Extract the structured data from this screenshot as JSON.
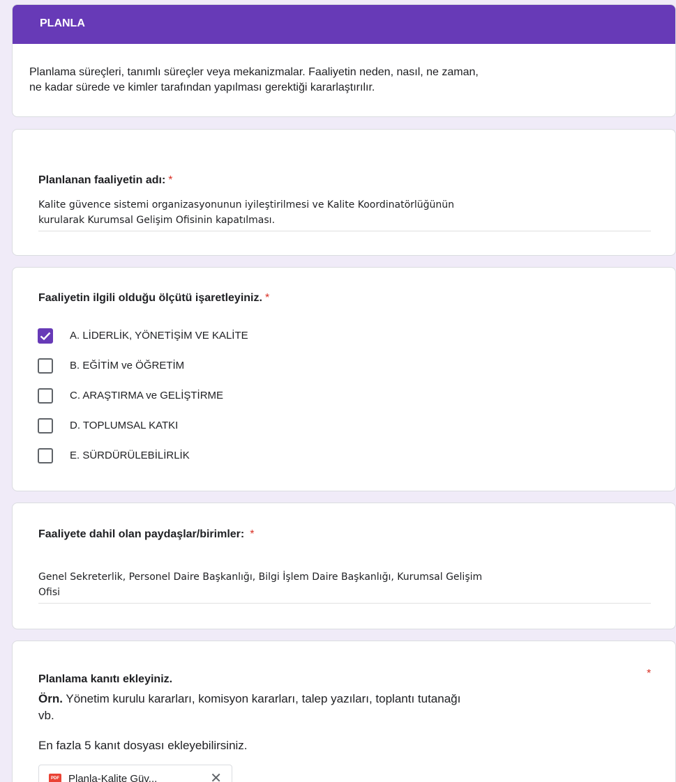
{
  "section": {
    "title": "PLANLA",
    "description_line1": "Planlama süreçleri, tanımlı süreçler veya mekanizmalar. Faaliyetin neden, nasıl, ne zaman,",
    "description_line2": "ne kadar sürede ve kimler tarafından yapılması gerektiği kararlaştırılır."
  },
  "q1": {
    "title": "Planlanan faaliyetin adı:",
    "required_mark": "*",
    "answer_line1": "Kalite güvence sistemi organizasyonunun iyileştirilmesi ve Kalite Koordinatörlüğünün",
    "answer_line2": "kurularak Kurumsal Gelişim Ofisinin kapatılması."
  },
  "q2": {
    "title": "Faaliyetin ilgili olduğu ölçütü işaretleyiniz.",
    "required_mark": "*",
    "options": [
      {
        "label": "A. LİDERLİK, YÖNETİŞİM VE KALİTE",
        "checked": true
      },
      {
        "label": "B. EĞİTİM ve ÖĞRETİM",
        "checked": false
      },
      {
        "label": "C. ARAŞTIRMA ve GELİŞTİRME",
        "checked": false
      },
      {
        "label": "D. TOPLUMSAL KATKI",
        "checked": false
      },
      {
        "label": "E. SÜRDÜRÜLEBİLİRLİK",
        "checked": false
      }
    ]
  },
  "q3": {
    "title": "Faaliyete dahil olan paydaşlar/birimler:",
    "required_mark": "*",
    "answer_line1": "Genel Sekreterlik, Personel Daire Başkanlığı, Bilgi İşlem Daire Başkanlığı, Kurumsal Gelişim",
    "answer_line2": "Ofisi"
  },
  "q4": {
    "title": "Planlama kanıtı ekleyiniz.",
    "required_mark": "*",
    "example_prefix": "Örn.",
    "example_line1": " Yönetim kurulu kararları, komisyon kararları, talep yazıları, toplantı tutanağı",
    "example_line2": "vb.",
    "limit_text": "En fazla 5 kanıt dosyası ekleyebilirsiniz.",
    "file": {
      "badge": "PDF",
      "name": "Planla-Kalite Güv...",
      "remove_glyph": "✕"
    }
  },
  "colors": {
    "accent": "#673ab7",
    "background": "#f0ebf8",
    "required": "#d93025"
  }
}
